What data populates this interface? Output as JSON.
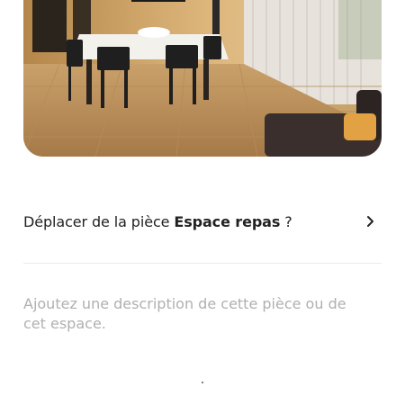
{
  "room_photo": {
    "icon": "room-photo"
  },
  "move_room": {
    "prefix": "Déplacer de la pièce ",
    "room_name": "Espace repas",
    "suffix": " ?",
    "icon": "chevron-right-icon"
  },
  "description": {
    "placeholder": "Ajoutez une description de cette pièce ou de cet espace.",
    "value": ""
  },
  "colors": {
    "text": "#222222",
    "placeholder": "#b0b0b0",
    "divider": "#ebebeb"
  }
}
